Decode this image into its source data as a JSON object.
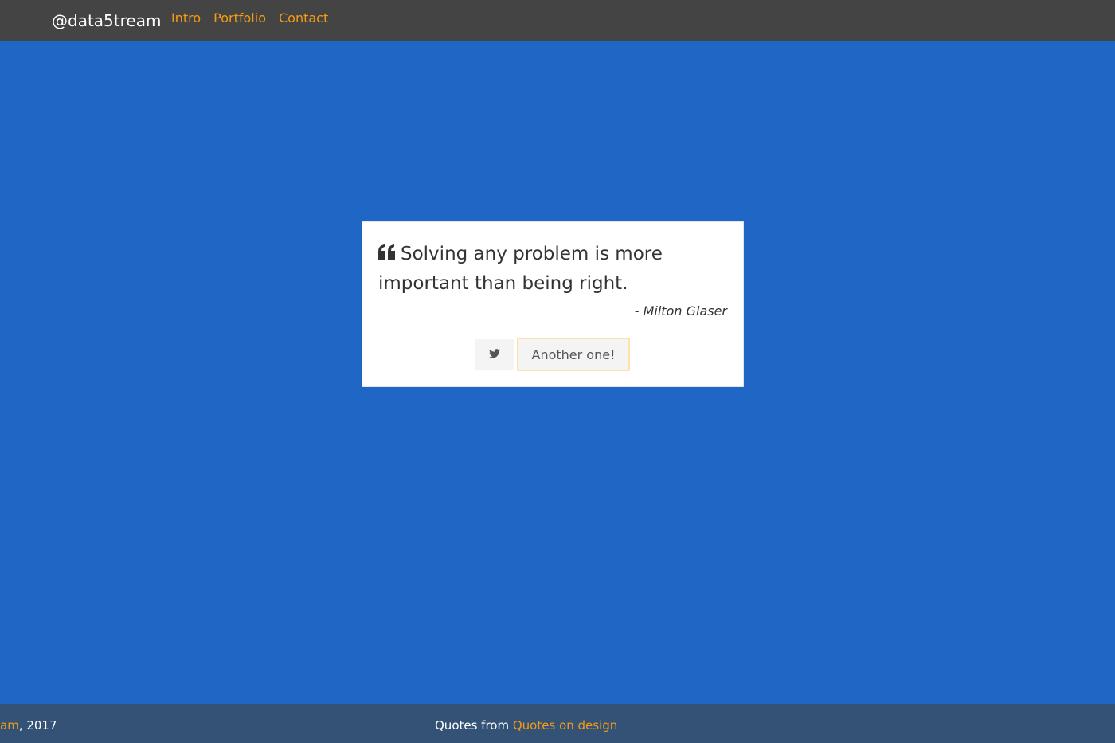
{
  "navbar": {
    "brand": "@data5tream",
    "links": [
      {
        "label": "Intro"
      },
      {
        "label": "Portfolio"
      },
      {
        "label": "Contact"
      }
    ],
    "background": "#444444",
    "link_color": "#f39c12"
  },
  "quote": {
    "text": "Solving any problem is more important than being right.",
    "author": "- Milton Glaser",
    "icon": "quote-left-icon"
  },
  "buttons": {
    "tweet_icon": "twitter-icon",
    "another_label": "Another one!"
  },
  "footer": {
    "copyright_link": "am",
    "copyright_year": ", 2017",
    "credit_prefix": "Quotes from ",
    "credit_link": "Quotes on design",
    "background": "#345276"
  },
  "colors": {
    "page_background": "#2067c5",
    "accent": "#f39c12"
  }
}
